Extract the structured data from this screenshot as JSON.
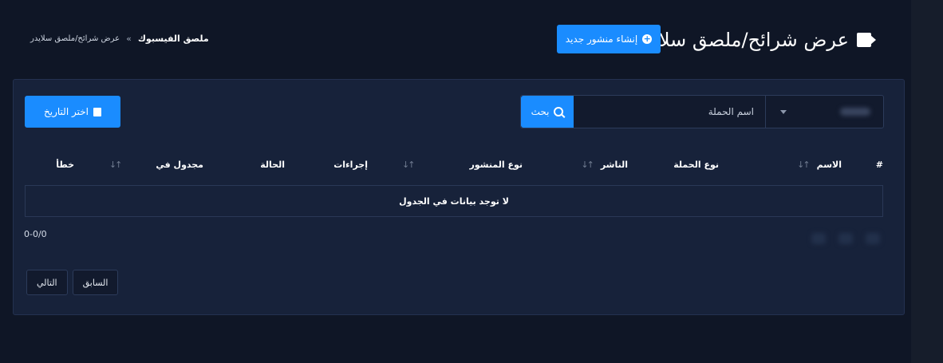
{
  "header": {
    "title": "عرض شرائح/ملصق سلايدر",
    "title_icon": "video-camera-icon",
    "create_button": "إنشاء منشور جديد"
  },
  "breadcrumb": {
    "home": "ملصق الفيسبوك",
    "separator": "»",
    "current": "عرض شرائح/ملصق سلايدر"
  },
  "filters": {
    "date_button": "اختر التاريخ",
    "campaign_placeholder": "اسم الحملة",
    "search_button": "بحث"
  },
  "table": {
    "columns": [
      "#",
      "الاسم",
      "نوع الحملة",
      "الناشر",
      "نوع المنشور",
      "إجراءات",
      "الحالة",
      "مجدول في",
      "خطأ"
    ],
    "empty_message": "لا توجد بيانات في الجدول",
    "range": "0-0/0"
  },
  "pagination": {
    "prev": "السابق",
    "next": "التالي"
  },
  "colors": {
    "accent": "#1a8cff",
    "background": "#0f1626",
    "card": "#17223a"
  }
}
